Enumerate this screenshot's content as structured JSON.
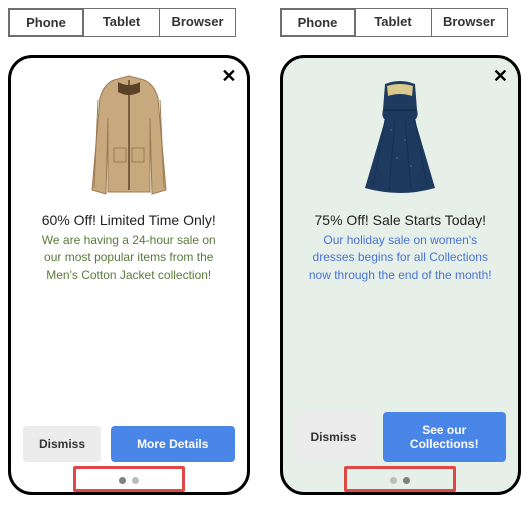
{
  "tabs": {
    "phone": "Phone",
    "tablet": "Tablet",
    "browser": "Browser"
  },
  "left": {
    "close": "✕",
    "headline": "60% Off! Limited Time Only!",
    "subtext": "We are having a 24-hour sale on our most popular items from the Men's Cotton Jacket collection!",
    "dismiss": "Dismiss",
    "cta": "More Details"
  },
  "right": {
    "close": "✕",
    "headline": "75% Off! Sale Starts Today!",
    "subtext": "Our holiday sale on women's dresses begins for all Collections now through the end of the month!",
    "dismiss": "Dismiss",
    "cta": "See our Collections!"
  }
}
